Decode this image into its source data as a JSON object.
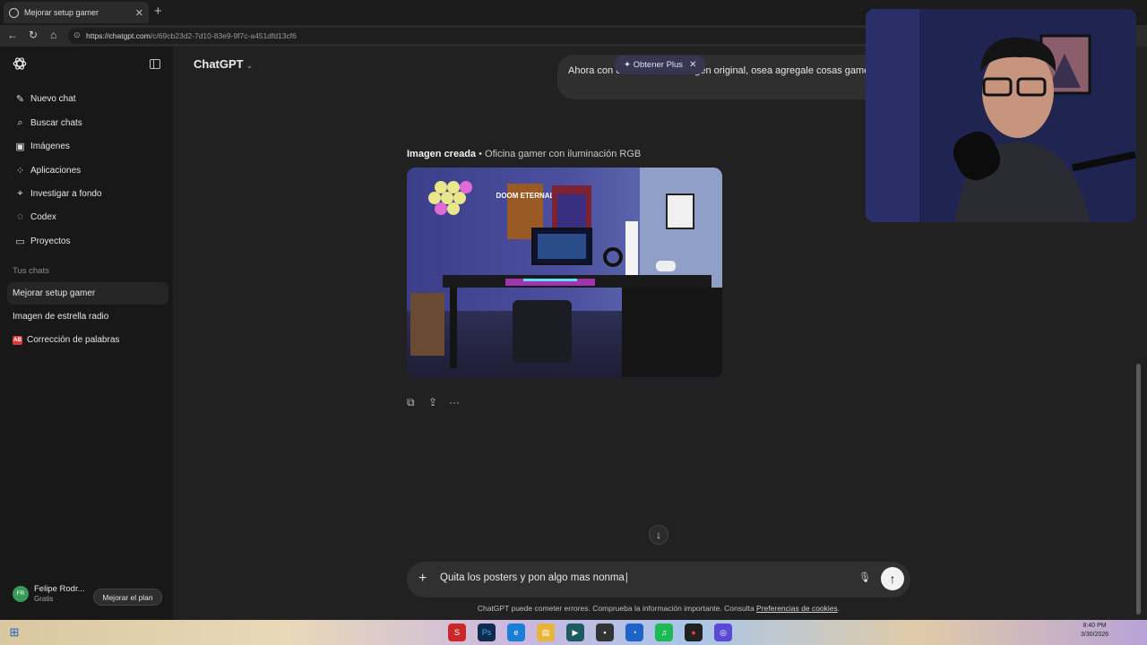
{
  "browser": {
    "tab_title": "Mejorar setup gamer",
    "url_domain": "https://chatgpt.com",
    "url_path": "/c/69cb23d2-7d10-83e9-9f7c-a451dfd13cf6"
  },
  "sidebar": {
    "nav": [
      {
        "label": "Nuevo chat",
        "icon": "edit-icon"
      },
      {
        "label": "Buscar chats",
        "icon": "search-icon"
      },
      {
        "label": "Imágenes",
        "icon": "image-icon"
      },
      {
        "label": "Aplicaciones",
        "icon": "apps-icon"
      },
      {
        "label": "Investigar a fondo",
        "icon": "telescope-icon"
      },
      {
        "label": "Codex",
        "icon": "code-icon"
      },
      {
        "label": "Proyectos",
        "icon": "folder-icon"
      }
    ],
    "chats_heading": "Tus chats",
    "chats": [
      {
        "label": "Mejorar setup gamer"
      },
      {
        "label": "Imagen de estrella radio"
      },
      {
        "label": "Corrección de palabras",
        "badge": "AB"
      }
    ],
    "user": {
      "initials": "FR",
      "name": "Felipe Rodr...",
      "plan": "Gratis"
    },
    "upgrade_label": "Mejorar el plan"
  },
  "main": {
    "model_label": "ChatGPT",
    "user_message": "Ahora con e mantener la imagen original, osea agregale cosas gamers",
    "plus_button": "Obtener Plus",
    "image_caption_bold": "Imagen creada",
    "image_caption_rest": " • Oficina gamer con iluminación RGB",
    "image_posters": [
      "DOOM ETERNAL"
    ],
    "composer_text": "Quita los posters y pon algo mas nonma",
    "disclaimer": "ChatGPT puede cometer errores. Comprueba la información importante. Consulta ",
    "disclaimer_link": "Preferencias de cookies",
    "disclaimer_end": "."
  },
  "taskbar": {
    "time": "8:40 PM",
    "date": "3/30/2026"
  },
  "colors": {
    "sidebar_bg": "#181818",
    "main_bg": "#212121",
    "bubble_bg": "#2f2f2f",
    "accent_plus": "#373651"
  }
}
